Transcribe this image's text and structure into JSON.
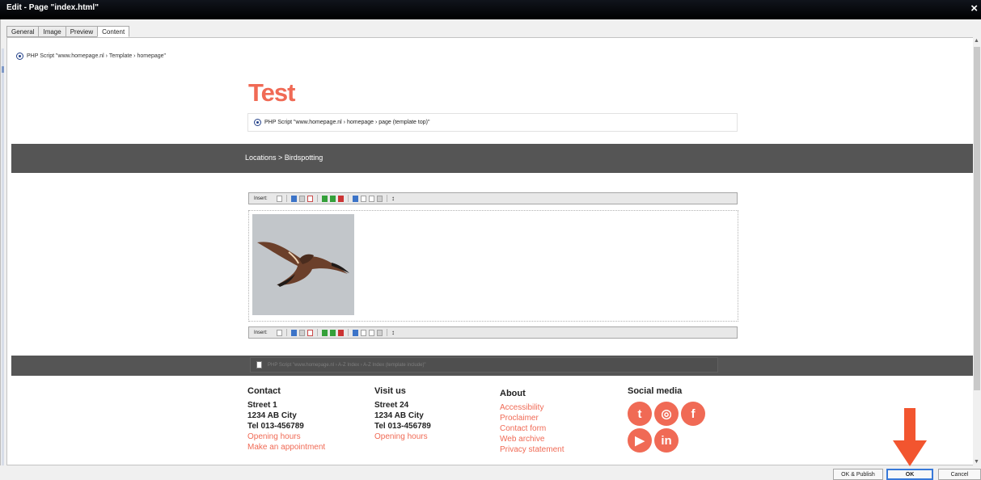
{
  "window": {
    "title": "Edit - Page \"index.html\"",
    "close": "×"
  },
  "tabs": [
    "General",
    "Image",
    "Preview",
    "Content"
  ],
  "top_php": "PHP Script \"www.homepage.nl › Template › homepage\"",
  "site_title": "Test",
  "page_php": "PHP Script \"www.homepage.nl › homepage › page (template top)\"",
  "breadcrumb": "Locations > Birdspotting",
  "insert_label": "Insert:",
  "include_php": "PHP Script \"www.homepage.nl › A-Z Index › A-Z Index (template include)\"",
  "footer": {
    "contact": {
      "heading": "Contact",
      "lines": [
        "Street 1",
        "1234 AB City",
        "Tel 013-456789"
      ],
      "links": [
        "Opening hours",
        "Make an appointment"
      ]
    },
    "visit": {
      "heading": "Visit us",
      "lines": [
        "Street 24",
        "1234 AB  City",
        "Tel 013-456789"
      ],
      "links": [
        "Opening hours"
      ]
    },
    "about": {
      "heading": "About",
      "links": [
        "Accessibility",
        "Proclaimer",
        "Contact form",
        "Web archive",
        "Privacy statement"
      ]
    },
    "social": {
      "heading": "Social media",
      "icons": [
        "twitter-icon",
        "instagram-icon",
        "facebook-icon",
        "youtube-icon",
        "linkedin-icon"
      ]
    }
  },
  "buttons": {
    "publish": "OK & Publish",
    "ok": "OK",
    "cancel": "Cancel"
  },
  "colors": {
    "accent": "#f06a55",
    "band": "#555555",
    "arrow": "#f2552f"
  }
}
